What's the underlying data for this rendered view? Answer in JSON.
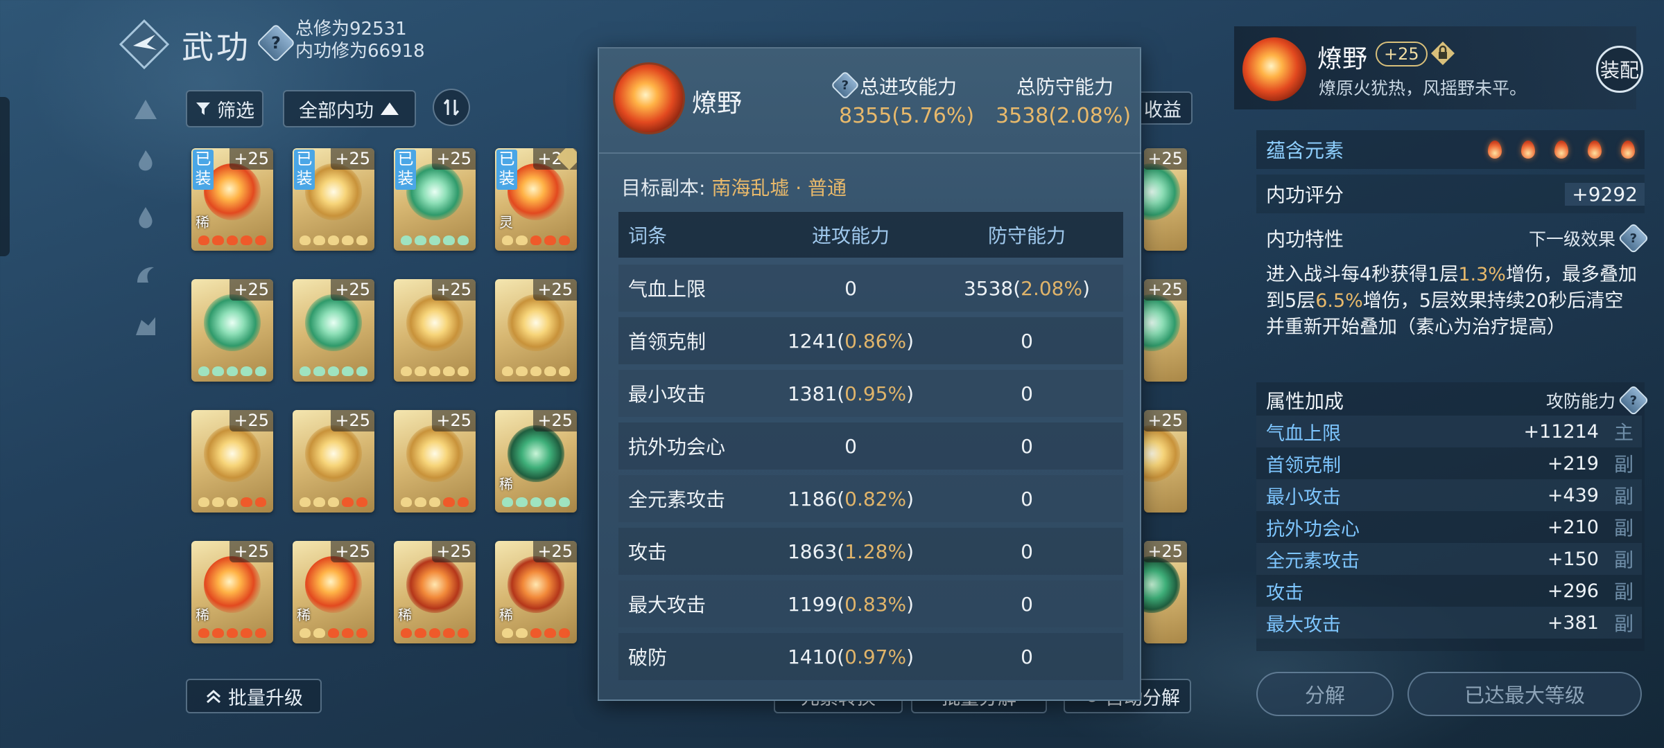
{
  "header": {
    "title": "武功",
    "total_cultivation": "总修为92531",
    "inner_cultivation": "内功修为66918"
  },
  "filters": {
    "filter_label": "筛选",
    "category_label": "全部内功",
    "batch_upgrade_label": "批量升级",
    "partial_right_label": "收益",
    "bottom_hidden": [
      "元素转换",
      "批量分解",
      "自动分解"
    ]
  },
  "cards": [
    {
      "type": "fire",
      "level": "+25",
      "equipped": "已装",
      "tag": "稀",
      "dots": "fire"
    },
    {
      "type": "gold",
      "level": "+25",
      "equipped": "已装",
      "tag": "",
      "dots": "gold"
    },
    {
      "type": "green",
      "level": "+25",
      "equipped": "已装",
      "tag": "",
      "dots": "green"
    },
    {
      "type": "fire",
      "level": "+25",
      "equipped": "已装",
      "tag": "灵",
      "dots": "mixed",
      "locked": true
    },
    {
      "type": "green",
      "level": "+25",
      "equipped": "",
      "tag": "",
      "dots": "green"
    },
    {
      "type": "green",
      "level": "+25",
      "equipped": "",
      "tag": "",
      "dots": "green"
    },
    {
      "type": "gold",
      "level": "+25",
      "equipped": "",
      "tag": "",
      "dots": "gold"
    },
    {
      "type": "gold",
      "level": "+25",
      "equipped": "",
      "tag": "",
      "dots": "gold"
    },
    {
      "type": "gold",
      "level": "+25",
      "equipped": "",
      "tag": "",
      "dots": "goldfire"
    },
    {
      "type": "gold",
      "level": "+25",
      "equipped": "",
      "tag": "",
      "dots": "goldfire"
    },
    {
      "type": "gold",
      "level": "+25",
      "equipped": "",
      "tag": "",
      "dots": "goldfire"
    },
    {
      "type": "jade",
      "level": "+25",
      "equipped": "",
      "tag": "稀",
      "dots": "green"
    },
    {
      "type": "fire",
      "level": "+25",
      "equipped": "",
      "tag": "稀",
      "dots": "fire"
    },
    {
      "type": "fire",
      "level": "+25",
      "equipped": "",
      "tag": "稀",
      "dots": "mixed"
    },
    {
      "type": "orb",
      "level": "+25",
      "equipped": "",
      "tag": "稀",
      "dots": "fire"
    },
    {
      "type": "orb",
      "level": "+25",
      "equipped": "",
      "tag": "稀",
      "dots": "mixed"
    }
  ],
  "hidden_column_levels": [
    "+25",
    "+25",
    "+25",
    "+25"
  ],
  "popup": {
    "name": "燎野",
    "total_attack_label": "总进攻能力",
    "total_attack_value": "8355(5.76%)",
    "total_defense_label": "总防守能力",
    "total_defense_value": "3538(2.08%)",
    "target_label": "目标副本:",
    "target_value": "南海乱墟 · 普通",
    "table_headers": [
      "词条",
      "进攻能力",
      "防守能力"
    ],
    "rows": [
      {
        "name": "气血上限",
        "atk": "0",
        "atk_pct": "",
        "def": "3538",
        "def_pct": "2.08%"
      },
      {
        "name": "首领克制",
        "atk": "1241",
        "atk_pct": "0.86%",
        "def": "0",
        "def_pct": ""
      },
      {
        "name": "最小攻击",
        "atk": "1381",
        "atk_pct": "0.95%",
        "def": "0",
        "def_pct": ""
      },
      {
        "name": "抗外功会心",
        "atk": "0",
        "atk_pct": "",
        "def": "0",
        "def_pct": ""
      },
      {
        "name": "全元素攻击",
        "atk": "1186",
        "atk_pct": "0.82%",
        "def": "0",
        "def_pct": ""
      },
      {
        "name": "攻击",
        "atk": "1863",
        "atk_pct": "1.28%",
        "def": "0",
        "def_pct": ""
      },
      {
        "name": "最大攻击",
        "atk": "1199",
        "atk_pct": "0.83%",
        "def": "0",
        "def_pct": ""
      },
      {
        "name": "破防",
        "atk": "1410",
        "atk_pct": "0.97%",
        "def": "0",
        "def_pct": ""
      }
    ]
  },
  "right_panel": {
    "name": "燎野",
    "level": "+25",
    "description": "燎原火犹热，风摇野未平。",
    "equip_label": "装配",
    "element_label": "蕴含元素",
    "element_count": 5,
    "score_label": "内功评分",
    "score_value": "+9292",
    "trait_label": "内功特性",
    "next_level_label": "下一级效果",
    "trait_text_parts": [
      {
        "t": "进入战斗每4秒获得1层",
        "h": false
      },
      {
        "t": "1.3%",
        "h": true
      },
      {
        "t": "增伤，最多叠加到5层",
        "h": false
      },
      {
        "t": "6.5%",
        "h": true
      },
      {
        "t": "增伤，5层效果持续20秒后清空并重新开始叠加（素心为治疗提高）",
        "h": false
      }
    ],
    "attr_label": "属性加成",
    "attr_right_label": "攻防能力",
    "attributes": [
      {
        "name": "气血上限",
        "value": "+11214",
        "tag": "主"
      },
      {
        "name": "首领克制",
        "value": "+219",
        "tag": "副"
      },
      {
        "name": "最小攻击",
        "value": "+439",
        "tag": "副"
      },
      {
        "name": "抗外功会心",
        "value": "+210",
        "tag": "副"
      },
      {
        "name": "全元素攻击",
        "value": "+150",
        "tag": "副"
      },
      {
        "name": "攻击",
        "value": "+296",
        "tag": "副"
      },
      {
        "name": "最大攻击",
        "value": "+381",
        "tag": "副"
      }
    ],
    "decompose_label": "分解",
    "max_level_label": "已达最大等级"
  },
  "colors": {
    "accent_gold": "#e8b96b",
    "attr_blue": "#7ec6ff",
    "popup_bg": "#3e5d75"
  }
}
